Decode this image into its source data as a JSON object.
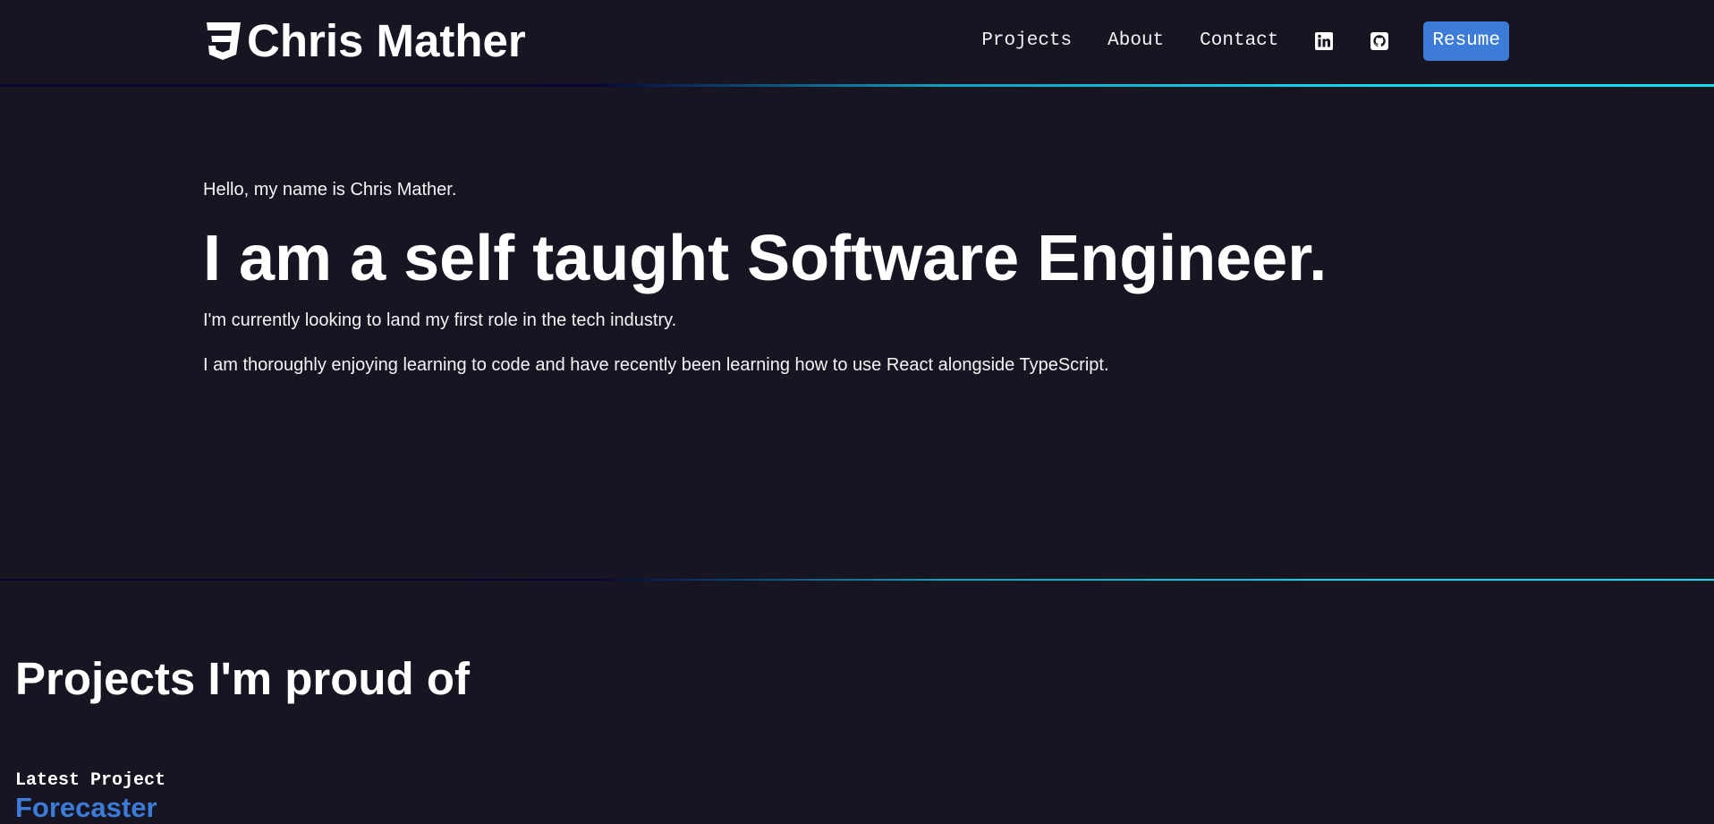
{
  "header": {
    "brand_name": "Chris Mather",
    "brand_icon": "css3-shield-icon",
    "nav": {
      "projects": "Projects",
      "about": "About",
      "contact": "Contact"
    },
    "social_icons": [
      "linkedin-icon",
      "github-icon"
    ],
    "resume_label": "Resume"
  },
  "hero": {
    "greeting": "Hello, my name is Chris Mather.",
    "headline": "I am a self taught Software Engineer.",
    "paragraph_1": "I'm currently looking to land my first role in the tech industry.",
    "paragraph_2": "I am thoroughly enjoying learning to code and have recently been learning how to use React alongside TypeScript."
  },
  "projects": {
    "title": "Projects I'm proud of",
    "latest_label": "Latest Project",
    "latest_name": "Forecaster"
  },
  "colors": {
    "background": "#181523",
    "accent_blue": "#3d7bd8",
    "divider_cyan": "#16dff0",
    "text": "#ffffff"
  }
}
